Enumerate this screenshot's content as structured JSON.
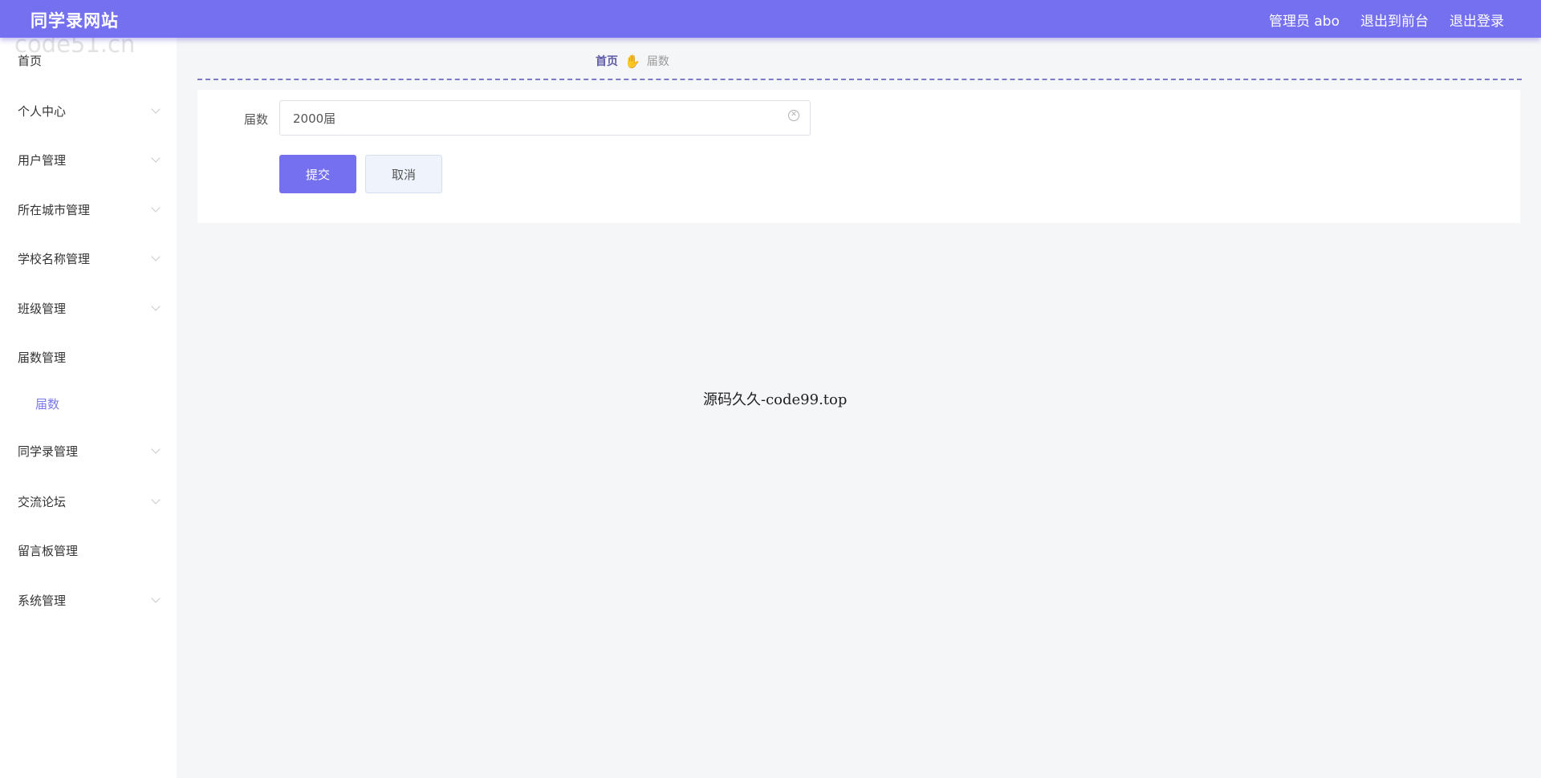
{
  "header": {
    "site_title": "同学录网站",
    "user_label": "管理员 abo",
    "front_link": "退出到前台",
    "logout_link": "退出登录",
    "accent_color": "#7570f0"
  },
  "sidebar": {
    "items": [
      {
        "label": "首页",
        "has_submenu": false
      },
      {
        "label": "个人中心",
        "has_submenu": true
      },
      {
        "label": "用户管理",
        "has_submenu": true
      },
      {
        "label": "所在城市管理",
        "has_submenu": true
      },
      {
        "label": "学校名称管理",
        "has_submenu": true
      },
      {
        "label": "班级管理",
        "has_submenu": true
      },
      {
        "label": "届数管理",
        "has_submenu": false
      },
      {
        "label": "同学录管理",
        "has_submenu": true
      },
      {
        "label": "交流论坛",
        "has_submenu": true
      },
      {
        "label": "留言板管理",
        "has_submenu": false
      },
      {
        "label": "系统管理",
        "has_submenu": true
      }
    ],
    "active_subitem": {
      "label": "届数"
    }
  },
  "breadcrumb": {
    "home": "首页",
    "separator_icon": "hand-icon",
    "current": "届数"
  },
  "form": {
    "field_label": "届数",
    "field_value": "2000届",
    "clear_icon": "circle-x-icon",
    "submit_label": "提交",
    "cancel_label": "取消"
  },
  "footer": {
    "text": "源码久久-code99.top"
  },
  "watermark": {
    "text": "code51.cn"
  }
}
